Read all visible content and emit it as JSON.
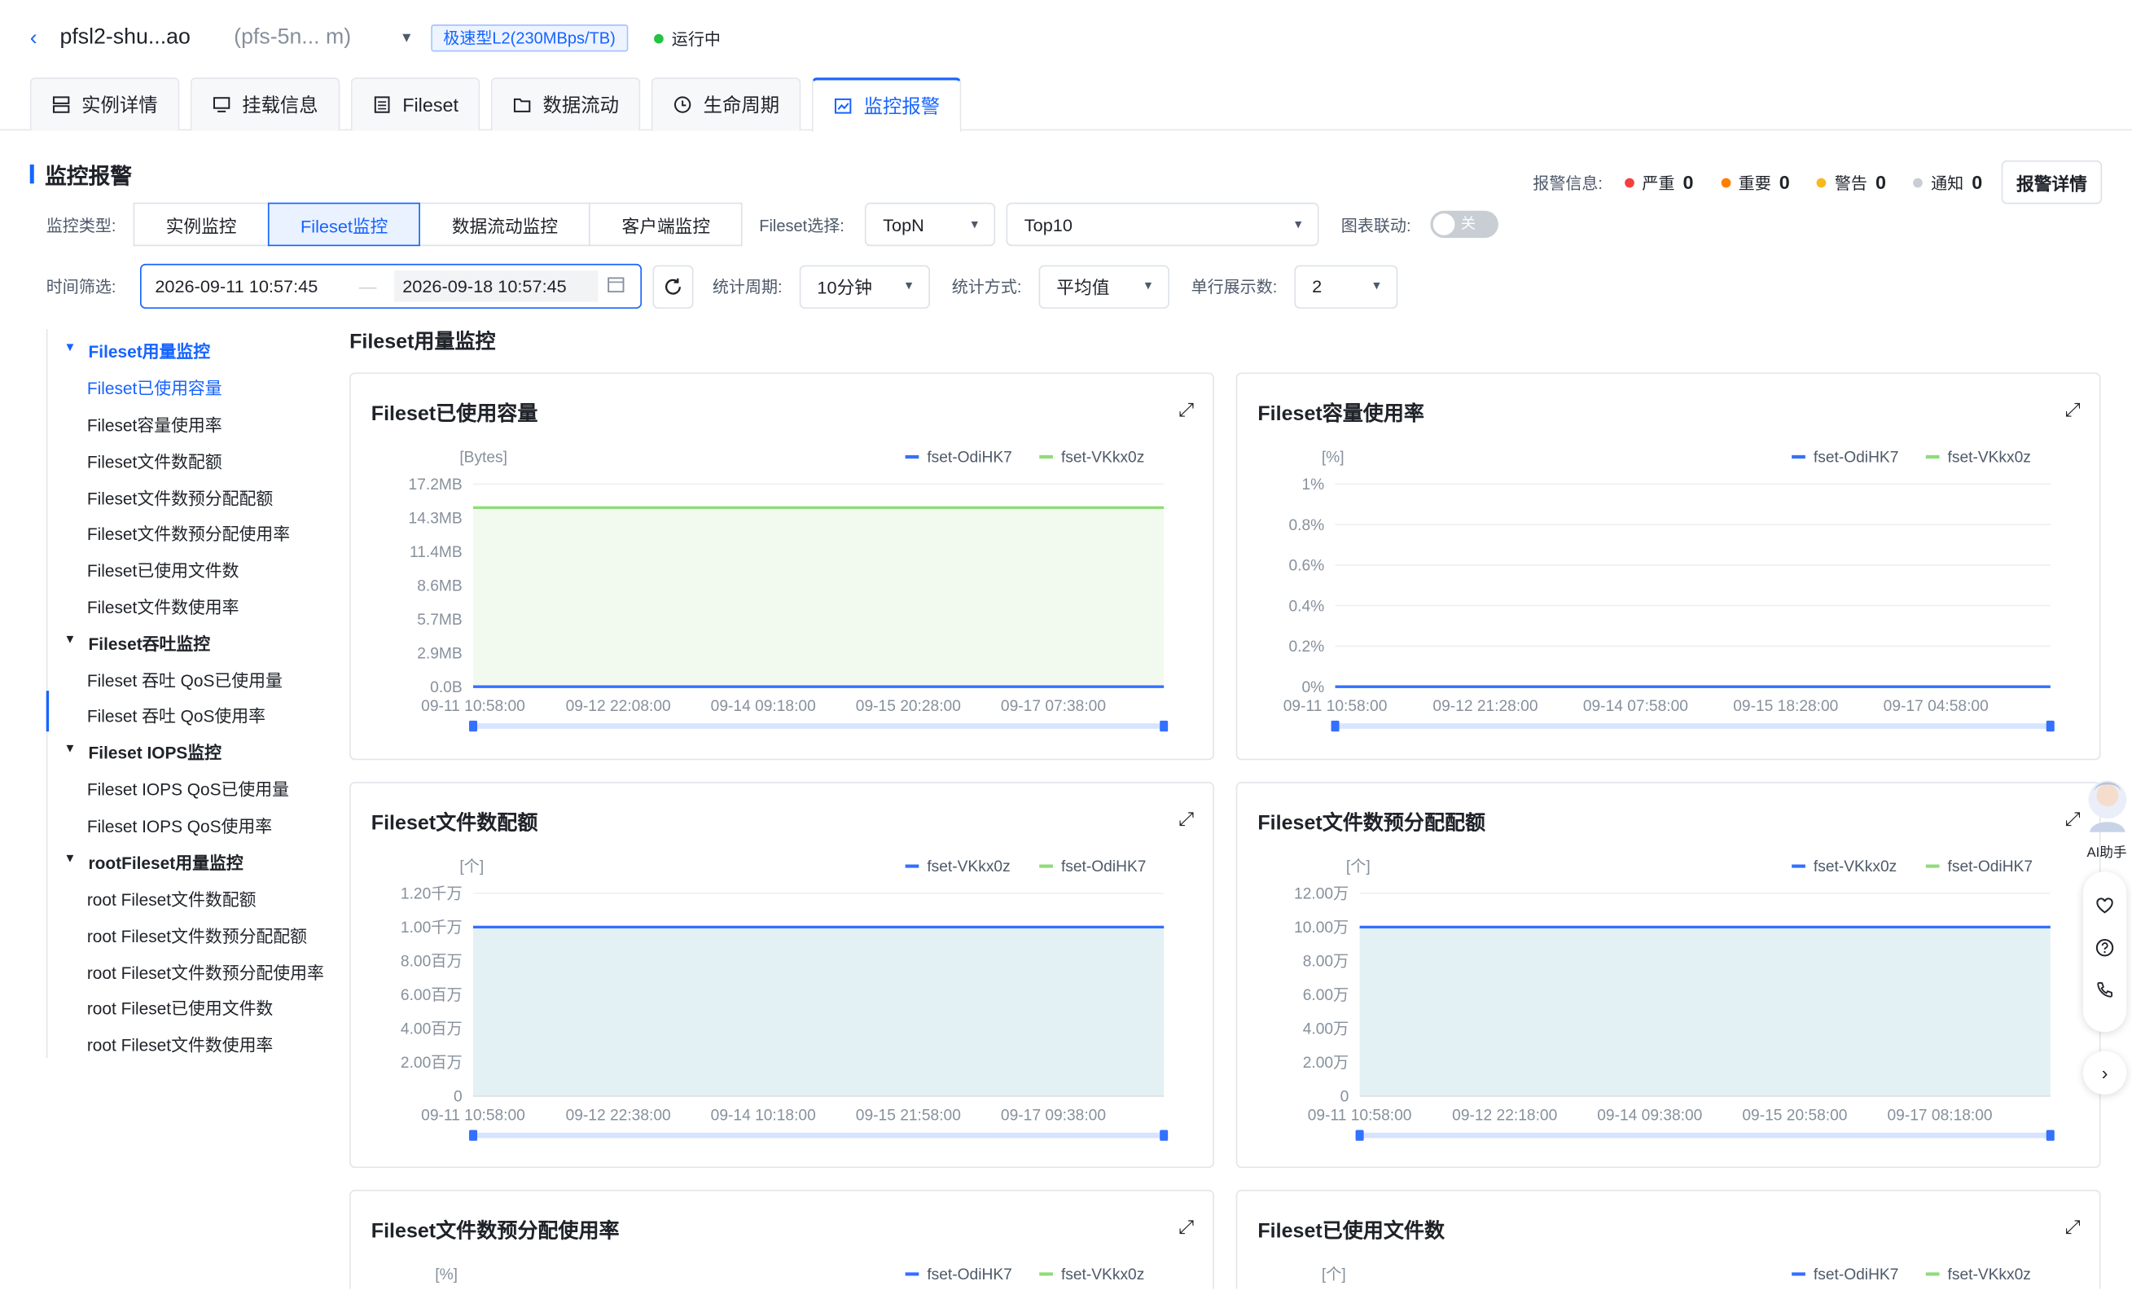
{
  "header": {
    "back": "‹",
    "instance_name": "pfsl2-shu...ao",
    "instance_id": "(pfs-5n... m)",
    "tag": "极速型L2(230MBps/TB)",
    "status": "运行中",
    "status_color": "#23c343"
  },
  "tabs": [
    {
      "label": "实例详情",
      "icon": "server-icon"
    },
    {
      "label": "挂载信息",
      "icon": "monitor-icon"
    },
    {
      "label": "Fileset",
      "icon": "list-icon"
    },
    {
      "label": "数据流动",
      "icon": "folder-icon"
    },
    {
      "label": "生命周期",
      "icon": "clock-icon"
    },
    {
      "label": "监控报警",
      "icon": "chart-icon",
      "active": true
    }
  ],
  "section": {
    "title": "监控报警"
  },
  "alarm": {
    "label": "报警信息:",
    "items": [
      {
        "name": "严重",
        "count": "0",
        "color": "#f53f3f"
      },
      {
        "name": "重要",
        "count": "0",
        "color": "#ff7d00"
      },
      {
        "name": "警告",
        "count": "0",
        "color": "#f7ba1e"
      },
      {
        "name": "通知",
        "count": "0",
        "color": "#c9cdd4"
      }
    ],
    "detail_btn": "报警详情"
  },
  "filters": {
    "type_label": "监控类型:",
    "types": [
      "实例监控",
      "Fileset监控",
      "数据流动监控",
      "客户端监控"
    ],
    "active_type": 1,
    "fileset_label": "Fileset选择:",
    "fileset_mode": "TopN",
    "fileset_top": "Top10",
    "link_label": "图表联动:",
    "link_state": "关",
    "time_label": "时间筛选:",
    "start": "2026-09-11 10:57:45",
    "sep": "—",
    "end": "2026-09-18 10:57:45",
    "period_label": "统计周期:",
    "period": "10分钟",
    "method_label": "统计方式:",
    "method": "平均值",
    "rows_label": "单行展示数:",
    "rows": "2"
  },
  "nav": {
    "groups": [
      {
        "label": "Fileset用量监控",
        "items": [
          "Fileset已使用容量",
          "Fileset容量使用率",
          "Fileset文件数配额",
          "Fileset文件数预分配配额",
          "Fileset文件数预分配使用率",
          "Fileset已使用文件数",
          "Fileset文件数使用率"
        ]
      },
      {
        "label": "Fileset吞吐监控",
        "items": [
          "Fileset 吞吐 QoS已使用量",
          "Fileset 吞吐 QoS使用率"
        ]
      },
      {
        "label": "Fileset IOPS监控",
        "items": [
          "Fileset IOPS QoS已使用量",
          "Fileset IOPS QoS使用率"
        ]
      },
      {
        "label": "rootFileset用量监控",
        "items": [
          "root Fileset文件数配额",
          "root Fileset文件数预分配配额",
          "root Fileset文件数预分配使用率",
          "root Fileset已使用文件数",
          "root Fileset文件数使用率"
        ]
      }
    ]
  },
  "area_title": "Fileset用量监控",
  "float": {
    "ai_label": "AI助手"
  },
  "chart_data": [
    {
      "type": "line",
      "title": "Fileset已使用容量",
      "unit": "[Bytes]",
      "yticks": [
        "17.2MB",
        "14.3MB",
        "11.4MB",
        "8.6MB",
        "5.7MB",
        "2.9MB",
        "0.0B"
      ],
      "ylim": [
        0,
        17.2
      ],
      "xticks": [
        "09-11 10:58:00",
        "09-12 22:08:00",
        "09-14 09:18:00",
        "09-15 20:28:00",
        "09-17 07:38:00"
      ],
      "series": [
        {
          "name": "fset-OdiHK7",
          "color": "#3370ff",
          "values": [
            0,
            0
          ]
        },
        {
          "name": "fset-VKkx0z",
          "color": "#8fdc7a",
          "values": [
            15.2,
            15.2
          ]
        }
      ],
      "fill": "#f2faf0"
    },
    {
      "type": "line",
      "title": "Fileset容量使用率",
      "unit": "[%]",
      "yticks": [
        "1%",
        "0.8%",
        "0.6%",
        "0.4%",
        "0.2%",
        "0%"
      ],
      "ylim": [
        0,
        1
      ],
      "xticks": [
        "09-11 10:58:00",
        "09-12 21:28:00",
        "09-14 07:58:00",
        "09-15 18:28:00",
        "09-17 04:58:00"
      ],
      "series": [
        {
          "name": "fset-OdiHK7",
          "color": "#3370ff",
          "values": [
            0,
            0
          ]
        },
        {
          "name": "fset-VKkx0z",
          "color": "#8fdc7a",
          "values": [
            0,
            0
          ]
        }
      ],
      "fill": ""
    },
    {
      "type": "area",
      "title": "Fileset文件数配额",
      "unit": "[个]",
      "yticks": [
        "1.20千万",
        "1.00千万",
        "8.00百万",
        "6.00百万",
        "4.00百万",
        "2.00百万",
        "0"
      ],
      "ylim": [
        0,
        12000000
      ],
      "xticks": [
        "09-11 10:58:00",
        "09-12 22:38:00",
        "09-14 10:18:00",
        "09-15 21:58:00",
        "09-17 09:38:00"
      ],
      "series": [
        {
          "name": "fset-VKkx0z",
          "color": "#3370ff",
          "values": [
            10000000,
            10000000
          ]
        },
        {
          "name": "fset-OdiHK7",
          "color": "#8fdc7a",
          "values": [
            10000000,
            10000000
          ]
        }
      ],
      "fill": "#e3f0f4"
    },
    {
      "type": "area",
      "title": "Fileset文件数预分配配额",
      "unit": "[个]",
      "yticks": [
        "12.00万",
        "10.00万",
        "8.00万",
        "6.00万",
        "4.00万",
        "2.00万",
        "0"
      ],
      "ylim": [
        0,
        120000
      ],
      "xticks": [
        "09-11 10:58:00",
        "09-12 22:18:00",
        "09-14 09:38:00",
        "09-15 20:58:00",
        "09-17 08:18:00"
      ],
      "series": [
        {
          "name": "fset-VKkx0z",
          "color": "#3370ff",
          "values": [
            100000,
            100000
          ]
        },
        {
          "name": "fset-OdiHK7",
          "color": "#8fdc7a",
          "values": [
            100000,
            100000
          ]
        }
      ],
      "fill": "#e3f0f4"
    },
    {
      "type": "line",
      "title": "Fileset文件数预分配使用率",
      "unit": "[%]",
      "series": [
        {
          "name": "fset-OdiHK7",
          "color": "#3370ff"
        },
        {
          "name": "fset-VKkx0z",
          "color": "#8fdc7a"
        }
      ]
    },
    {
      "type": "line",
      "title": "Fileset已使用文件数",
      "unit": "[个]",
      "series": [
        {
          "name": "fset-OdiHK7",
          "color": "#3370ff"
        },
        {
          "name": "fset-VKkx0z",
          "color": "#8fdc7a"
        }
      ]
    }
  ]
}
